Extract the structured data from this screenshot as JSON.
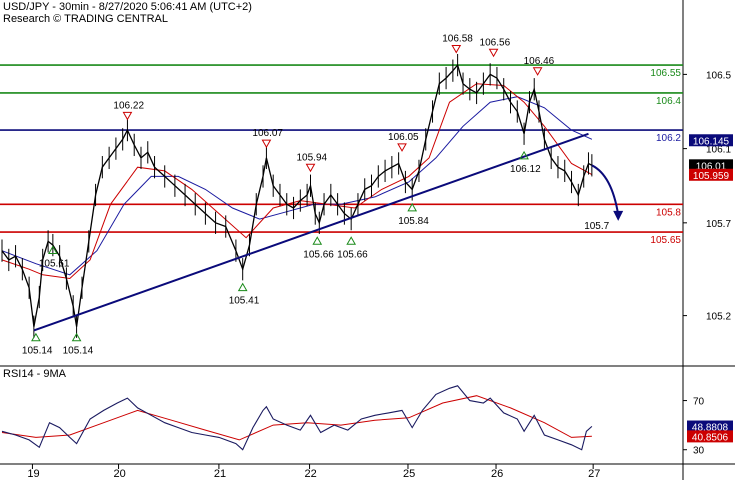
{
  "header": {
    "title": "USD/JPY - 30min - 8/27/2020 5:06:41 AM (UTC+2)",
    "source": "Research © TRADING CENTRAL"
  },
  "rsi": {
    "label": "RSI14 - 9MA",
    "value": "48.8808",
    "ma_value": "40.8506"
  },
  "colors": {
    "price": "#000000",
    "ma_red": "#cc0000",
    "ma_blue": "#1a1aa0",
    "green_line": "#1a8a1a",
    "red_line": "#cc0000",
    "navy": "#0a0a7a",
    "label_green": "#1a8a1a",
    "label_red": "#cc0000",
    "label_blue": "#1a1aa0"
  },
  "chart_data": {
    "type": "line",
    "title": "USD/JPY - 30min",
    "x_ticks": [
      "19",
      "20",
      "21",
      "22",
      "25",
      "26",
      "27"
    ],
    "price_axis": {
      "ticks": [
        "106.5",
        "106.1",
        "105.7",
        "105.2"
      ],
      "ylim": [
        104.95,
        106.75
      ]
    },
    "levels": [
      {
        "value": 106.55,
        "label": "106.55",
        "color": "green"
      },
      {
        "value": 106.4,
        "label": "106.4",
        "color": "green"
      },
      {
        "value": 106.2,
        "label": "106.2",
        "color": "navy"
      },
      {
        "value": 105.8,
        "label": "105.8",
        "color": "red"
      },
      {
        "value": 105.65,
        "label": "105.65",
        "color": "red"
      }
    ],
    "axis_labels": [
      {
        "value": 106.145,
        "text": "106.145",
        "bg": "#0a0a7a"
      },
      {
        "value": 106.01,
        "text": "106.01",
        "bg": "#000000"
      },
      {
        "value": 105.959,
        "text": "105.959",
        "bg": "#cc0000"
      }
    ],
    "highs": [
      {
        "label": "106.22",
        "xt": 0.185,
        "value": 106.22
      },
      {
        "label": "106.07",
        "xt": 0.39,
        "value": 106.07
      },
      {
        "label": "105.94",
        "xt": 0.455,
        "value": 105.94
      },
      {
        "label": "106.05",
        "xt": 0.59,
        "value": 106.05
      },
      {
        "label": "106.58",
        "xt": 0.67,
        "value": 106.58
      },
      {
        "label": "106.56",
        "xt": 0.725,
        "value": 106.56
      },
      {
        "label": "106.46",
        "xt": 0.79,
        "value": 106.46
      }
    ],
    "lows": [
      {
        "label": "105.14",
        "xt": 0.05,
        "value": 105.14
      },
      {
        "label": "105.14",
        "xt": 0.11,
        "value": 105.14
      },
      {
        "label": "105.61",
        "xt": 0.075,
        "value": 105.61
      },
      {
        "label": "105.41",
        "xt": 0.355,
        "value": 105.41
      },
      {
        "label": "105.66",
        "xt": 0.465,
        "value": 105.66
      },
      {
        "label": "105.66",
        "xt": 0.515,
        "value": 105.66
      },
      {
        "label": "105.84",
        "xt": 0.605,
        "value": 105.84
      },
      {
        "label": "106.12",
        "xt": 0.77,
        "value": 106.12
      }
    ],
    "trendline": {
      "from": [
        0.047,
        105.12
      ],
      "to": [
        0.865,
        106.18
      ]
    },
    "projection": {
      "from": [
        0.87,
        106.01
      ],
      "to": [
        0.9,
        105.7
      ],
      "target_label": "105.7"
    },
    "close_series": [
      [
        0.0,
        105.55
      ],
      [
        0.01,
        105.5
      ],
      [
        0.02,
        105.52
      ],
      [
        0.03,
        105.45
      ],
      [
        0.04,
        105.35
      ],
      [
        0.047,
        105.14
      ],
      [
        0.055,
        105.3
      ],
      [
        0.06,
        105.5
      ],
      [
        0.068,
        105.6
      ],
      [
        0.075,
        105.58
      ],
      [
        0.085,
        105.52
      ],
      [
        0.095,
        105.4
      ],
      [
        0.105,
        105.25
      ],
      [
        0.11,
        105.14
      ],
      [
        0.118,
        105.35
      ],
      [
        0.128,
        105.6
      ],
      [
        0.138,
        105.85
      ],
      [
        0.148,
        106.0
      ],
      [
        0.158,
        106.05
      ],
      [
        0.168,
        106.1
      ],
      [
        0.178,
        106.15
      ],
      [
        0.185,
        106.2
      ],
      [
        0.195,
        106.12
      ],
      [
        0.205,
        106.05
      ],
      [
        0.215,
        106.08
      ],
      [
        0.225,
        106.0
      ],
      [
        0.24,
        105.95
      ],
      [
        0.255,
        105.9
      ],
      [
        0.27,
        105.85
      ],
      [
        0.285,
        105.8
      ],
      [
        0.3,
        105.75
      ],
      [
        0.315,
        105.7
      ],
      [
        0.33,
        105.68
      ],
      [
        0.345,
        105.55
      ],
      [
        0.355,
        105.45
      ],
      [
        0.365,
        105.58
      ],
      [
        0.375,
        105.8
      ],
      [
        0.385,
        105.95
      ],
      [
        0.39,
        106.05
      ],
      [
        0.4,
        105.9
      ],
      [
        0.41,
        105.85
      ],
      [
        0.42,
        105.8
      ],
      [
        0.43,
        105.78
      ],
      [
        0.44,
        105.82
      ],
      [
        0.45,
        105.85
      ],
      [
        0.455,
        105.9
      ],
      [
        0.462,
        105.75
      ],
      [
        0.468,
        105.7
      ],
      [
        0.475,
        105.8
      ],
      [
        0.485,
        105.85
      ],
      [
        0.495,
        105.8
      ],
      [
        0.505,
        105.75
      ],
      [
        0.515,
        105.72
      ],
      [
        0.525,
        105.8
      ],
      [
        0.535,
        105.88
      ],
      [
        0.545,
        105.9
      ],
      [
        0.555,
        105.95
      ],
      [
        0.565,
        105.98
      ],
      [
        0.575,
        106.0
      ],
      [
        0.585,
        106.02
      ],
      [
        0.595,
        105.92
      ],
      [
        0.605,
        105.88
      ],
      [
        0.615,
        105.98
      ],
      [
        0.625,
        106.15
      ],
      [
        0.635,
        106.3
      ],
      [
        0.645,
        106.45
      ],
      [
        0.655,
        106.48
      ],
      [
        0.665,
        106.52
      ],
      [
        0.672,
        106.55
      ],
      [
        0.68,
        106.45
      ],
      [
        0.69,
        106.42
      ],
      [
        0.7,
        106.4
      ],
      [
        0.71,
        106.45
      ],
      [
        0.72,
        106.5
      ],
      [
        0.73,
        106.48
      ],
      [
        0.74,
        106.42
      ],
      [
        0.75,
        106.35
      ],
      [
        0.76,
        106.3
      ],
      [
        0.77,
        106.18
      ],
      [
        0.778,
        106.35
      ],
      [
        0.785,
        106.42
      ],
      [
        0.792,
        106.3
      ],
      [
        0.8,
        106.15
      ],
      [
        0.81,
        106.05
      ],
      [
        0.82,
        106.0
      ],
      [
        0.83,
        105.98
      ],
      [
        0.84,
        105.92
      ],
      [
        0.85,
        105.85
      ],
      [
        0.858,
        105.95
      ],
      [
        0.865,
        106.02
      ],
      [
        0.87,
        106.01
      ]
    ],
    "ma_red": [
      [
        0.0,
        105.5
      ],
      [
        0.04,
        105.45
      ],
      [
        0.06,
        105.42
      ],
      [
        0.1,
        105.4
      ],
      [
        0.13,
        105.5
      ],
      [
        0.16,
        105.8
      ],
      [
        0.2,
        106.0
      ],
      [
        0.24,
        105.98
      ],
      [
        0.28,
        105.88
      ],
      [
        0.32,
        105.75
      ],
      [
        0.36,
        105.62
      ],
      [
        0.4,
        105.78
      ],
      [
        0.44,
        105.82
      ],
      [
        0.48,
        105.8
      ],
      [
        0.52,
        105.78
      ],
      [
        0.56,
        105.88
      ],
      [
        0.6,
        105.95
      ],
      [
        0.63,
        106.05
      ],
      [
        0.66,
        106.35
      ],
      [
        0.7,
        106.45
      ],
      [
        0.74,
        106.44
      ],
      [
        0.77,
        106.35
      ],
      [
        0.8,
        106.22
      ],
      [
        0.84,
        106.02
      ],
      [
        0.87,
        105.96
      ]
    ],
    "ma_blue": [
      [
        0.0,
        105.55
      ],
      [
        0.05,
        105.48
      ],
      [
        0.1,
        105.42
      ],
      [
        0.14,
        105.55
      ],
      [
        0.18,
        105.8
      ],
      [
        0.22,
        105.95
      ],
      [
        0.26,
        105.95
      ],
      [
        0.3,
        105.88
      ],
      [
        0.34,
        105.78
      ],
      [
        0.38,
        105.72
      ],
      [
        0.42,
        105.76
      ],
      [
        0.46,
        105.8
      ],
      [
        0.5,
        105.8
      ],
      [
        0.55,
        105.84
      ],
      [
        0.6,
        105.92
      ],
      [
        0.64,
        106.05
      ],
      [
        0.68,
        106.22
      ],
      [
        0.72,
        106.35
      ],
      [
        0.76,
        106.38
      ],
      [
        0.8,
        106.32
      ],
      [
        0.84,
        106.2
      ],
      [
        0.87,
        106.15
      ]
    ],
    "rsi_axis": {
      "ticks": [
        "70",
        "30"
      ],
      "ylim": [
        20,
        90
      ]
    },
    "rsi_series": [
      [
        0.0,
        45
      ],
      [
        0.02,
        42
      ],
      [
        0.04,
        38
      ],
      [
        0.055,
        32
      ],
      [
        0.07,
        52
      ],
      [
        0.085,
        48
      ],
      [
        0.1,
        40
      ],
      [
        0.11,
        35
      ],
      [
        0.13,
        55
      ],
      [
        0.15,
        62
      ],
      [
        0.17,
        68
      ],
      [
        0.185,
        72
      ],
      [
        0.2,
        64
      ],
      [
        0.22,
        58
      ],
      [
        0.24,
        52
      ],
      [
        0.26,
        48
      ],
      [
        0.28,
        44
      ],
      [
        0.3,
        42
      ],
      [
        0.32,
        40
      ],
      [
        0.345,
        35
      ],
      [
        0.355,
        30
      ],
      [
        0.37,
        48
      ],
      [
        0.385,
        62
      ],
      [
        0.39,
        65
      ],
      [
        0.4,
        55
      ],
      [
        0.42,
        50
      ],
      [
        0.44,
        46
      ],
      [
        0.455,
        58
      ],
      [
        0.47,
        44
      ],
      [
        0.49,
        50
      ],
      [
        0.51,
        46
      ],
      [
        0.53,
        55
      ],
      [
        0.55,
        58
      ],
      [
        0.57,
        60
      ],
      [
        0.59,
        62
      ],
      [
        0.605,
        48
      ],
      [
        0.62,
        62
      ],
      [
        0.64,
        75
      ],
      [
        0.66,
        80
      ],
      [
        0.672,
        82
      ],
      [
        0.69,
        70
      ],
      [
        0.71,
        68
      ],
      [
        0.72,
        72
      ],
      [
        0.74,
        60
      ],
      [
        0.76,
        55
      ],
      [
        0.77,
        45
      ],
      [
        0.785,
        58
      ],
      [
        0.8,
        42
      ],
      [
        0.82,
        38
      ],
      [
        0.84,
        34
      ],
      [
        0.855,
        30
      ],
      [
        0.862,
        45
      ],
      [
        0.87,
        49
      ]
    ],
    "rsi_ma": [
      [
        0.0,
        44
      ],
      [
        0.05,
        40
      ],
      [
        0.1,
        42
      ],
      [
        0.15,
        52
      ],
      [
        0.2,
        62
      ],
      [
        0.25,
        54
      ],
      [
        0.3,
        46
      ],
      [
        0.35,
        38
      ],
      [
        0.4,
        50
      ],
      [
        0.45,
        52
      ],
      [
        0.5,
        50
      ],
      [
        0.55,
        54
      ],
      [
        0.6,
        56
      ],
      [
        0.65,
        68
      ],
      [
        0.7,
        74
      ],
      [
        0.75,
        64
      ],
      [
        0.8,
        52
      ],
      [
        0.84,
        40
      ],
      [
        0.87,
        41
      ]
    ]
  }
}
